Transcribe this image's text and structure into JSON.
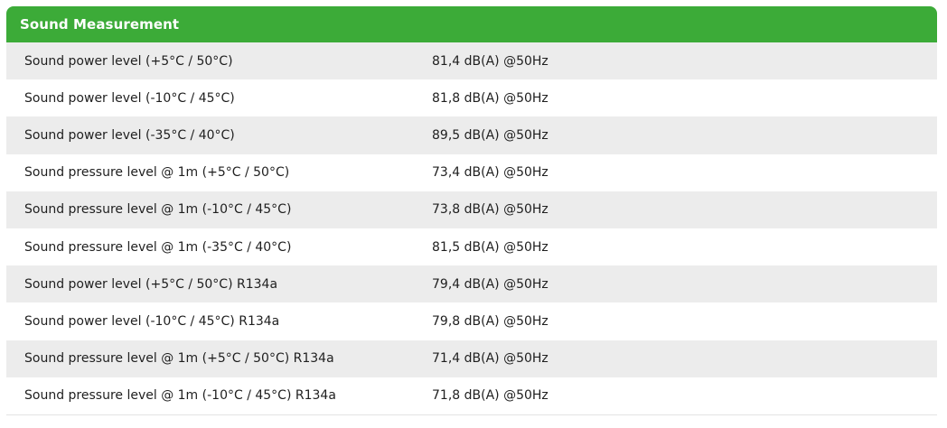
{
  "table": {
    "title": "Sound Measurement",
    "rows": [
      {
        "label": "Sound power level (+5°C / 50°C)",
        "value": "81,4 dB(A) @50Hz"
      },
      {
        "label": "Sound power level (-10°C / 45°C)",
        "value": "81,8 dB(A) @50Hz"
      },
      {
        "label": "Sound power level (-35°C / 40°C)",
        "value": "89,5 dB(A) @50Hz"
      },
      {
        "label": "Sound pressure level @ 1m (+5°C / 50°C)",
        "value": "73,4 dB(A) @50Hz"
      },
      {
        "label": "Sound pressure level @ 1m (-10°C / 45°C)",
        "value": "73,8 dB(A) @50Hz"
      },
      {
        "label": "Sound pressure level @ 1m (-35°C / 40°C)",
        "value": "81,5 dB(A) @50Hz"
      },
      {
        "label": "Sound power level (+5°C / 50°C) R134a",
        "value": "79,4 dB(A) @50Hz"
      },
      {
        "label": "Sound power level (-10°C / 45°C) R134a",
        "value": "79,8 dB(A) @50Hz"
      },
      {
        "label": "Sound pressure level @ 1m (+5°C / 50°C) R134a",
        "value": "71,4 dB(A) @50Hz"
      },
      {
        "label": "Sound pressure level @ 1m (-10°C / 45°C) R134a",
        "value": "71,8 dB(A) @50Hz"
      }
    ]
  },
  "colors": {
    "header_background": "#3cab38",
    "header_text": "#ffffff",
    "row_striped": "#ececec",
    "row_plain": "#ffffff",
    "text": "#1f1f1f"
  }
}
